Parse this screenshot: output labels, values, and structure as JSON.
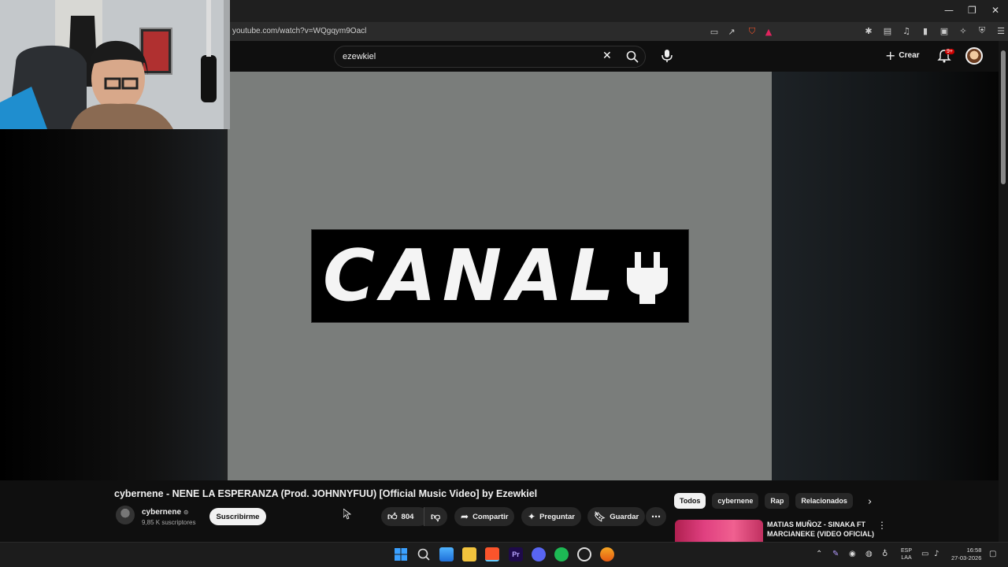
{
  "browser": {
    "url": "youtube.com/watch?v=WQgqym9Oacl"
  },
  "youtube": {
    "search_value": "ezewkiel",
    "create_label": "Crear",
    "notif_badge": "9+"
  },
  "video": {
    "frame_text": "CANAL+",
    "title": "cybernene - NENE LA ESPERANZA (Prod. JOHNNYFUU) [Official Music Video] by Ezewkiel"
  },
  "channel": {
    "name": "cybernene",
    "subscribers": "9,85 K suscriptores",
    "subscribe_label": "Suscribirme"
  },
  "actions": {
    "likes": "804",
    "share_label": "Compartir",
    "ask_label": "Preguntar",
    "save_label": "Guardar"
  },
  "chips": [
    "Todos",
    "cybernene",
    "Rap",
    "Relacionados"
  ],
  "recommendation": {
    "title": "MATIAS MUÑOZ - SINAKA FT MARCIANEKE (VIDEO OFICIAL)"
  },
  "taskbar": {
    "lang_line1": "ESP",
    "lang_line2": "LAA",
    "time": "16:58",
    "date": "27-03-2026"
  },
  "colors": {
    "accent_red": "#cc0000",
    "yt_bg": "#0f0f0f",
    "chip_bg": "#272727"
  }
}
